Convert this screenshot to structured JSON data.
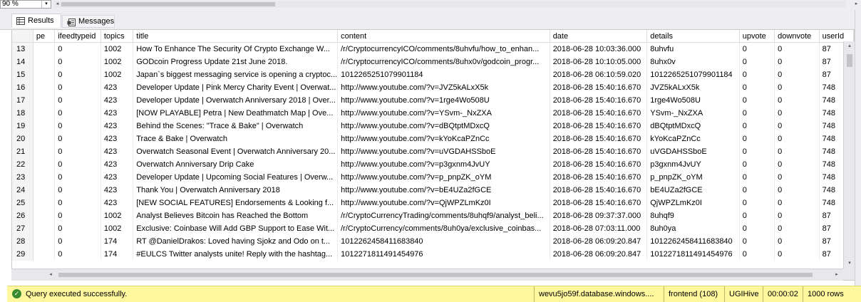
{
  "toolbar": {
    "zoom": "90 %",
    "zoom_arrow": "▾",
    "scroll_left": "◂",
    "scroll_right": "▸"
  },
  "tabs": {
    "results": "Results",
    "messages": "Messages"
  },
  "grid": {
    "columns": [
      "",
      "pe",
      "ifeedtypeid",
      "topics",
      "title",
      "content",
      "date",
      "details",
      "upvote",
      "downvote",
      "userId"
    ],
    "rows": [
      [
        "13",
        "",
        "0",
        "1002",
        "How To Enhance The Security Of Crypto Exchange W...",
        "/r/CryptocurrencyICO/comments/8uhvfu/how_to_enhan...",
        "2018-06-28 10:03:36.000",
        "8uhvfu",
        "0",
        "0",
        "87"
      ],
      [
        "14",
        "",
        "0",
        "1002",
        "GODcoin Progress Update 21st June 2018.",
        "/r/CryptocurrencyICO/comments/8uhx0v/godcoin_progr...",
        "2018-06-28 10:10:05.000",
        "8uhx0v",
        "0",
        "0",
        "87"
      ],
      [
        "15",
        "",
        "0",
        "1002",
        "Japan`s biggest messaging service is opening a cryptoc...",
        "1012265251079901184",
        "2018-06-28 06:10:59.020",
        "1012265251079901184",
        "0",
        "0",
        "87"
      ],
      [
        "16",
        "",
        "0",
        "423",
        "Developer Update | Pink Mercy Charity Event | Overwat...",
        "http://www.youtube.com/?v=JVZ5kALxX5k",
        "2018-06-28 15:40:16.670",
        "JVZ5kALxX5k",
        "0",
        "0",
        "748"
      ],
      [
        "17",
        "",
        "0",
        "423",
        "Developer Update | Overwatch Anniversary 2018 | Over...",
        "http://www.youtube.com/?v=1rge4Wo508U",
        "2018-06-28 15:40:16.670",
        "1rge4Wo508U",
        "0",
        "0",
        "748"
      ],
      [
        "18",
        "",
        "0",
        "423",
        "[NOW PLAYABLE] Petra | New Deathmatch Map | Ove...",
        "http://www.youtube.com/?v=YSvm-_NxZXA",
        "2018-06-28 15:40:16.670",
        "YSvm-_NxZXA",
        "0",
        "0",
        "748"
      ],
      [
        "19",
        "",
        "0",
        "423",
        "Behind the Scenes: \"Trace & Bake\" | Overwatch",
        "http://www.youtube.com/?v=dBQtptMDxcQ",
        "2018-06-28 15:40:16.670",
        "dBQtptMDxcQ",
        "0",
        "0",
        "748"
      ],
      [
        "20",
        "",
        "0",
        "423",
        "Trace & Bake | Overwatch",
        "http://www.youtube.com/?v=kYoKcaPZnCc",
        "2018-06-28 15:40:16.670",
        "kYoKcaPZnCc",
        "0",
        "0",
        "748"
      ],
      [
        "21",
        "",
        "0",
        "423",
        "Overwatch Seasonal Event | Overwatch Anniversary 20...",
        "http://www.youtube.com/?v=uVGDAHSSboE",
        "2018-06-28 15:40:16.670",
        "uVGDAHSSboE",
        "0",
        "0",
        "748"
      ],
      [
        "22",
        "",
        "0",
        "423",
        "Overwatch Anniversary Drip Cake",
        "http://www.youtube.com/?v=p3gxnm4JvUY",
        "2018-06-28 15:40:16.670",
        "p3gxnm4JvUY",
        "0",
        "0",
        "748"
      ],
      [
        "23",
        "",
        "0",
        "423",
        "Developer Update | Upcoming Social Features | Overw...",
        "http://www.youtube.com/?v=p_pnpZK_oYM",
        "2018-06-28 15:40:16.670",
        "p_pnpZK_oYM",
        "0",
        "0",
        "748"
      ],
      [
        "24",
        "",
        "0",
        "423",
        "Thank You | Overwatch Anniversary 2018",
        "http://www.youtube.com/?v=bE4UZa2fGCE",
        "2018-06-28 15:40:16.670",
        "bE4UZa2fGCE",
        "0",
        "0",
        "748"
      ],
      [
        "25",
        "",
        "0",
        "423",
        "[NEW SOCIAL FEATURES] Endorsements & Looking f...",
        "http://www.youtube.com/?v=QjWPZLmKz0I",
        "2018-06-28 15:40:16.670",
        "QjWPZLmKz0I",
        "0",
        "0",
        "748"
      ],
      [
        "26",
        "",
        "0",
        "1002",
        "Analyst Believes Bitcoin has Reached the Bottom",
        "/r/CryptoCurrencyTrading/comments/8uhqf9/analyst_beli...",
        "2018-06-28 09:37:37.000",
        "8uhqf9",
        "0",
        "0",
        "87"
      ],
      [
        "27",
        "",
        "0",
        "1002",
        "Exclusive: Coinbase Will Add GBP Support to Ease Wit...",
        "/r/CryptoCurrency/comments/8uh0ya/exclusive_coinbas...",
        "2018-06-28 07:03:11.000",
        "8uh0ya",
        "0",
        "0",
        "87"
      ],
      [
        "28",
        "",
        "0",
        "174",
        "RT @DanielDrakos: Loved having Sjokz and Odo on t...",
        "1012262458411683840",
        "2018-06-28 06:09:20.847",
        "1012262458411683840",
        "0",
        "0",
        "87"
      ],
      [
        "29",
        "",
        "0",
        "174",
        "#EULCS Twitter analysts unite!  Reply with the hashtag...",
        "1012271811491454976",
        "2018-06-28 06:09:20.847",
        "1012271811491454976",
        "0",
        "0",
        "87"
      ]
    ]
  },
  "scroll": {
    "up": "▴",
    "down": "▾",
    "left": "◂",
    "right": "▸"
  },
  "status": {
    "check": "✓",
    "message": "Query executed successfully.",
    "server": "wevu5jo59f.database.windows....",
    "user": "frontend (108)",
    "database": "UGIHive",
    "elapsed": "00:00:02",
    "rows": "1000 rows"
  },
  "colors": {
    "status_bg": "#fff79e",
    "status_ok": "#3a8a2e"
  }
}
